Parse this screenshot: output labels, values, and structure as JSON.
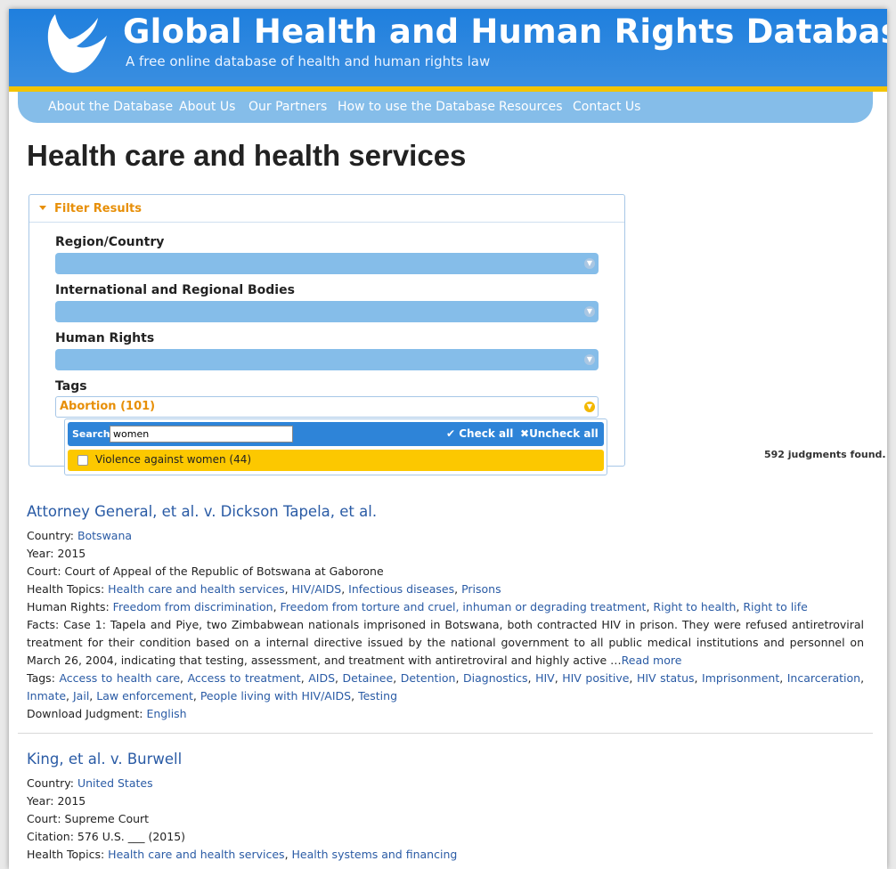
{
  "site": {
    "title": "Global Health and Human Rights Database",
    "tagline": "A free online database of health and human rights law"
  },
  "nav": [
    "About the Database",
    "About Us",
    "Our Partners",
    "How to use the Database",
    "Resources",
    "Contact Us"
  ],
  "page_title": "Health care and health services",
  "filter": {
    "header": "Filter Results",
    "region_label": "Region/Country",
    "bodies_label": "International and Regional Bodies",
    "rights_label": "Human Rights",
    "tags_label": "Tags",
    "tags_selected": "Abortion (101)",
    "dropdown": {
      "search_label": "Search",
      "search_value": "women",
      "check_all": "Check all",
      "uncheck_all": "Uncheck all",
      "option": "Violence against women (44)"
    }
  },
  "results_count": "592 judgments found.",
  "cases": [
    {
      "title": "Attorney General, et al. v. Dickson Tapela, et al.",
      "country_label": "Country",
      "country": "Botswana",
      "year_label": "Year",
      "year": "2015",
      "court_label": "Court",
      "court": "Court of Appeal of the Republic of Botswana at Gaborone",
      "topics_label": "Health Topics",
      "topics": [
        "Health care and health services",
        "HIV/AIDS",
        "Infectious diseases",
        "Prisons"
      ],
      "rights_label": "Human Rights",
      "rights": [
        "Freedom from discrimination",
        "Freedom from torture and cruel, inhuman or degrading treatment",
        "Right to health",
        "Right to life"
      ],
      "facts_label": "Facts",
      "facts": "Case 1: Tapela and Piye, two Zimbabwean nationals imprisoned in Botswana, both contracted HIV in prison. They were refused antiretroviral treatment for their condition based on a internal directive issued by the national government to all public medical institutions and personnel on March 26, 2004, indicating that testing, assessment, and treatment with antiretroviral and highly active …",
      "read_more": "Read more",
      "tags_label": "Tags",
      "tags": [
        "Access to health care",
        "Access to treatment",
        "AIDS",
        "Detainee",
        "Detention",
        "Diagnostics",
        "HIV",
        "HIV positive",
        "HIV status",
        "Imprisonment",
        "Incarceration",
        "Inmate",
        "Jail",
        "Law enforcement",
        "People living with HIV/AIDS",
        "Testing"
      ],
      "download_label": "Download Judgment",
      "download": "English"
    },
    {
      "title": "King, et al. v. Burwell",
      "country_label": "Country",
      "country": "United States",
      "year_label": "Year",
      "year": "2015",
      "court_label": "Court",
      "court": "Supreme Court",
      "citation_label": "Citation",
      "citation": "576 U.S. ___ (2015)",
      "topics_label": "Health Topics",
      "topics": [
        "Health care and health services",
        "Health systems and financing"
      ]
    }
  ]
}
